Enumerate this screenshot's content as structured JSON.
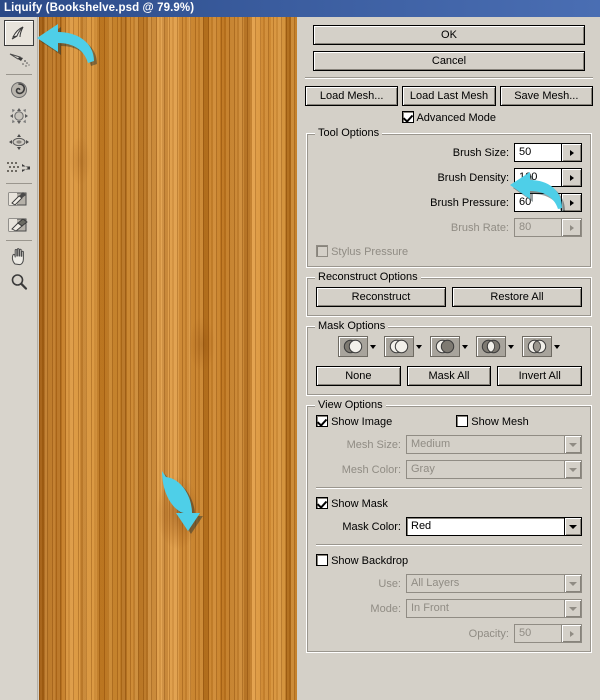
{
  "window": {
    "title": "Liquify (Bookshelve.psd @ 79.9%)"
  },
  "toolbar": {
    "tools": [
      {
        "name": "forward-warp-tool",
        "label": "Forward Warp Tool",
        "selected": true
      },
      {
        "name": "reconstruct-tool",
        "label": "Reconstruct Tool",
        "selected": false
      },
      {
        "name": "twirl-clockwise-tool",
        "label": "Twirl Clockwise Tool",
        "selected": false
      },
      {
        "name": "pucker-tool",
        "label": "Pucker Tool",
        "selected": false
      },
      {
        "name": "bloat-tool",
        "label": "Bloat Tool",
        "selected": false
      },
      {
        "name": "push-left-tool",
        "label": "Push Left Tool",
        "selected": false
      },
      {
        "name": "freeze-mask-tool",
        "label": "Freeze Mask Tool",
        "selected": false
      },
      {
        "name": "thaw-mask-tool",
        "label": "Thaw Mask Tool",
        "selected": false
      },
      {
        "name": "hand-tool",
        "label": "Hand Tool",
        "selected": false
      },
      {
        "name": "zoom-tool",
        "label": "Zoom Tool",
        "selected": false
      }
    ]
  },
  "canvas": {
    "description": "wood-grain bookshelf image preview"
  },
  "annotations": [
    {
      "name": "arrow-to-warp-tool",
      "color": "#4ecfe8",
      "direction": "left"
    },
    {
      "name": "arrow-to-brush-density",
      "color": "#4ecfe8",
      "direction": "left"
    },
    {
      "name": "arrow-to-warped-wood",
      "color": "#4ecfe8",
      "direction": "down"
    }
  ],
  "panel": {
    "ok_label": "OK",
    "cancel_label": "Cancel",
    "mesh_buttons": [
      {
        "name": "load-mesh-button",
        "label": "Load Mesh..."
      },
      {
        "name": "load-last-mesh-button",
        "label": "Load Last Mesh"
      },
      {
        "name": "save-mesh-button",
        "label": "Save Mesh..."
      }
    ],
    "advanced_mode": {
      "label": "Advanced Mode",
      "checked": true
    },
    "tool_options": {
      "legend": "Tool Options",
      "fields": [
        {
          "name": "brush-size",
          "label": "Brush Size:",
          "value": "50",
          "disabled": false
        },
        {
          "name": "brush-density",
          "label": "Brush Density:",
          "value": "100",
          "disabled": false
        },
        {
          "name": "brush-pressure",
          "label": "Brush Pressure:",
          "value": "60",
          "disabled": false
        },
        {
          "name": "brush-rate",
          "label": "Brush Rate:",
          "value": "80",
          "disabled": true
        }
      ],
      "stylus_pressure": {
        "label": "Stylus Pressure",
        "checked": false,
        "disabled": true
      }
    },
    "reconstruct_options": {
      "legend": "Reconstruct Options",
      "reconstruct_label": "Reconstruct",
      "restore_all_label": "Restore All"
    },
    "mask_options": {
      "legend": "Mask Options",
      "modes": [
        {
          "name": "mask-mode-replace-selection",
          "glyph": "replace"
        },
        {
          "name": "mask-mode-add-to-selection",
          "glyph": "add"
        },
        {
          "name": "mask-mode-subtract-from-selection",
          "glyph": "subtract"
        },
        {
          "name": "mask-mode-intersect-with-selection",
          "glyph": "intersect"
        },
        {
          "name": "mask-mode-invert-selection",
          "glyph": "invert"
        }
      ],
      "none_label": "None",
      "mask_all_label": "Mask All",
      "invert_all_label": "Invert All"
    },
    "view_options": {
      "legend": "View Options",
      "show_image": {
        "label": "Show Image",
        "checked": true
      },
      "show_mesh": {
        "label": "Show Mesh",
        "checked": false
      },
      "mesh_size": {
        "label": "Mesh Size:",
        "value": "Medium",
        "disabled": true
      },
      "mesh_color": {
        "label": "Mesh Color:",
        "value": "Gray",
        "disabled": true
      },
      "show_mask": {
        "label": "Show Mask",
        "checked": true
      },
      "mask_color": {
        "label": "Mask Color:",
        "value": "Red",
        "disabled": false
      },
      "show_backdrop": {
        "label": "Show Backdrop",
        "checked": false
      },
      "use": {
        "label": "Use:",
        "value": "All Layers",
        "disabled": true
      },
      "mode": {
        "label": "Mode:",
        "value": "In Front",
        "disabled": true
      },
      "opacity": {
        "label": "Opacity:",
        "value": "50",
        "disabled": true
      }
    }
  }
}
